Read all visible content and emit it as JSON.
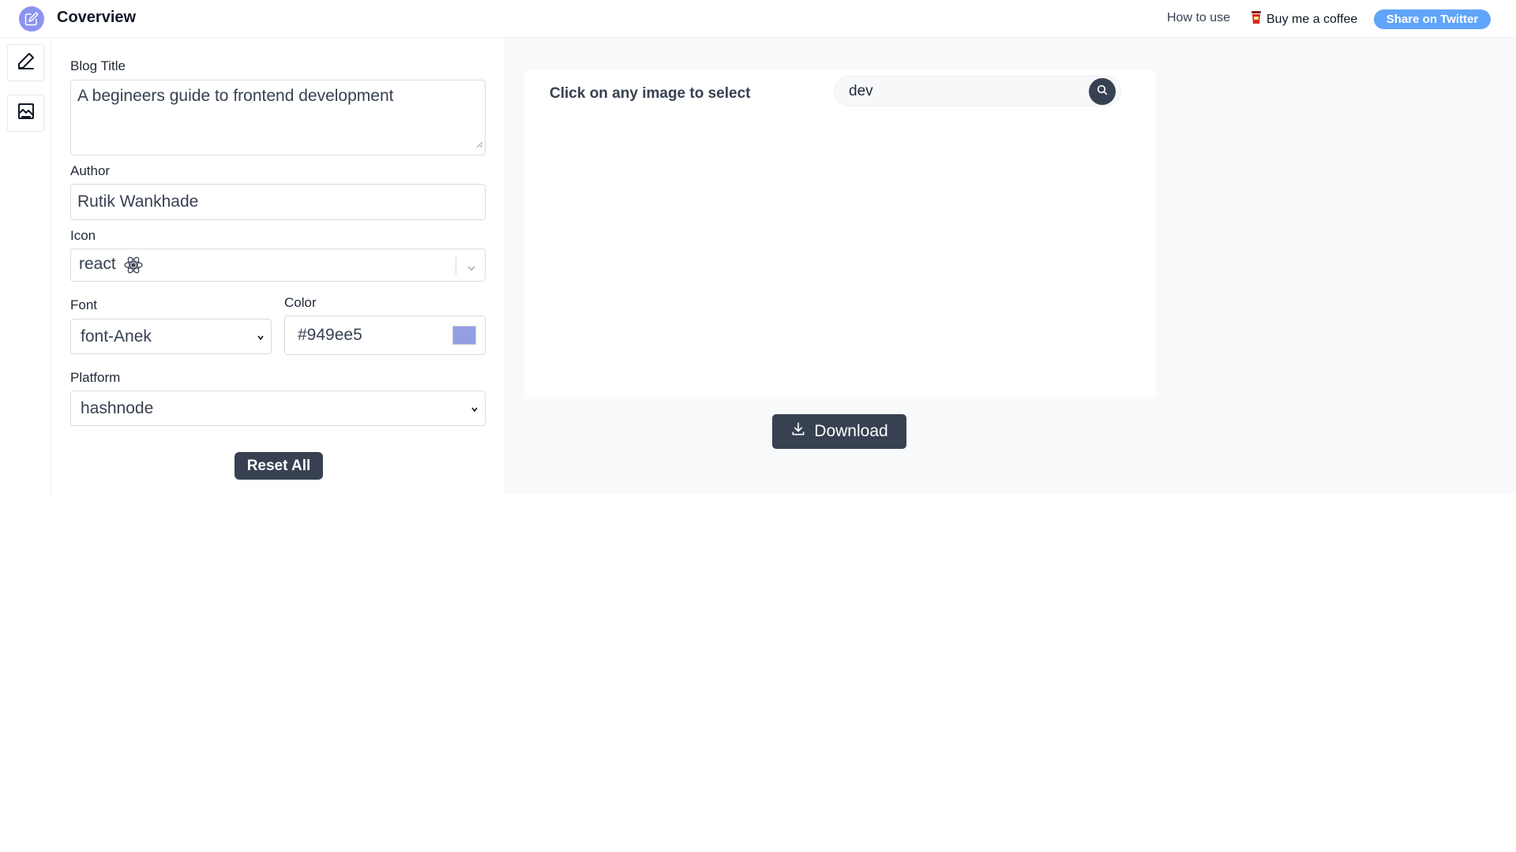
{
  "header": {
    "app_title": "Coverview",
    "nav": {
      "how_to_use": "How to use",
      "buy_coffee": "Buy me a coffee",
      "share_twitter": "Share on Twitter"
    }
  },
  "rail": {
    "items": [
      {
        "icon": "pencil-icon"
      },
      {
        "icon": "image-icon"
      }
    ]
  },
  "form": {
    "blog_title_label": "Blog Title",
    "blog_title_value": "A begineers guide to frontend development",
    "author_label": "Author",
    "author_value": "Rutik Wankhade",
    "icon_label": "Icon",
    "icon_value": "react",
    "font_label": "Font",
    "font_value": "font-Anek",
    "color_label": "Color",
    "color_value": "#949ee5",
    "platform_label": "Platform",
    "platform_value": "hashnode",
    "reset_label": "Reset All"
  },
  "preview": {
    "select_prompt": "Click on any image to select",
    "search_value": "dev",
    "download_label": "Download"
  },
  "colors": {
    "accent": "#949ee5",
    "dark_button": "#374151",
    "twitter": "#60a5fa"
  }
}
